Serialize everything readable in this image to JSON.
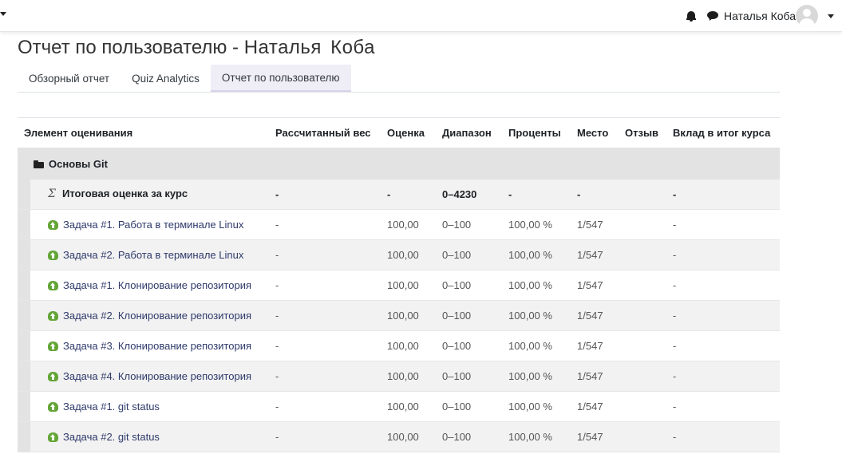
{
  "header": {
    "user_name": "Наталья Коба",
    "icons": [
      "bell-icon",
      "message-icon",
      "avatar",
      "chevron-down-icon"
    ]
  },
  "page": {
    "title_prefix": "Отчет по пользователю - ",
    "title_user": "Наталья Коба"
  },
  "tabs": [
    {
      "label": "Обзорный отчет",
      "active": false
    },
    {
      "label": "Quiz Analytics",
      "active": false
    },
    {
      "label": "Отчет по пользователю",
      "active": true
    }
  ],
  "table": {
    "columns": [
      "Элемент оценивания",
      "Рассчитанный вес",
      "Оценка",
      "Диапазон",
      "Проценты",
      "Место",
      "Отзыв",
      "Вклад в итог курса"
    ],
    "category": {
      "name": "Основы Git",
      "icon": "folder-icon"
    },
    "total": {
      "label": "Итоговая оценка за курс",
      "icon": "sigma-icon",
      "weight": "-",
      "grade": "-",
      "range": "0–4230",
      "percent": "-",
      "rank": "-",
      "feedback": "",
      "contribution": "-"
    },
    "rows": [
      {
        "label": "Задача #1. Работа в терминале Linux",
        "weight": "-",
        "grade": "100,00",
        "range": "0–100",
        "percent": "100,00 %",
        "rank": "1/547",
        "feedback": "",
        "contribution": "-"
      },
      {
        "label": "Задача #2. Работа в терминале Linux",
        "weight": "-",
        "grade": "100,00",
        "range": "0–100",
        "percent": "100,00 %",
        "rank": "1/547",
        "feedback": "",
        "contribution": "-"
      },
      {
        "label": "Задача #1. Клонирование репозитория",
        "weight": "-",
        "grade": "100,00",
        "range": "0–100",
        "percent": "100,00 %",
        "rank": "1/547",
        "feedback": "",
        "contribution": "-"
      },
      {
        "label": "Задача #2. Клонирование репозитория",
        "weight": "-",
        "grade": "100,00",
        "range": "0–100",
        "percent": "100,00 %",
        "rank": "1/547",
        "feedback": "",
        "contribution": "-"
      },
      {
        "label": "Задача #3. Клонирование репозитория",
        "weight": "-",
        "grade": "100,00",
        "range": "0–100",
        "percent": "100,00 %",
        "rank": "1/547",
        "feedback": "",
        "contribution": "-"
      },
      {
        "label": "Задача #4. Клонирование репозитория",
        "weight": "-",
        "grade": "100,00",
        "range": "0–100",
        "percent": "100,00 %",
        "rank": "1/547",
        "feedback": "",
        "contribution": "-"
      },
      {
        "label": "Задача #1. git status",
        "weight": "-",
        "grade": "100,00",
        "range": "0–100",
        "percent": "100,00 %",
        "rank": "1/547",
        "feedback": "",
        "contribution": "-"
      },
      {
        "label": "Задача #2. git status",
        "weight": "-",
        "grade": "100,00",
        "range": "0–100",
        "percent": "100,00 %",
        "rank": "1/547",
        "feedback": "",
        "contribution": "-"
      }
    ],
    "row_icon": "assignment-upload-icon"
  }
}
